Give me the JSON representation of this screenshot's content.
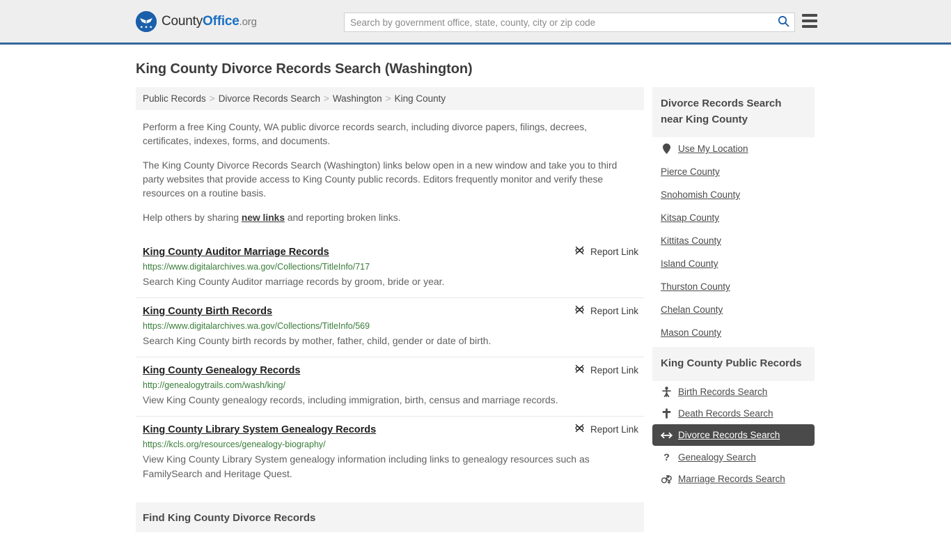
{
  "header": {
    "logo": {
      "icon": "eagle-shield-icon",
      "part1": "County",
      "part2": "Office",
      "part3": ".org"
    },
    "search": {
      "placeholder": "Search by government office, state, county, city or zip code",
      "value": "",
      "icon": "search-icon"
    },
    "menu_icon": "hamburger-menu-icon"
  },
  "page": {
    "title": "King County Divorce Records Search (Washington)"
  },
  "breadcrumb": {
    "items": [
      {
        "label": "Public Records"
      },
      {
        "label": "Divorce Records Search"
      },
      {
        "label": "Washington"
      },
      {
        "label": "King County"
      }
    ],
    "separator": ">"
  },
  "intro": {
    "p1": "Perform a free King County, WA public divorce records search, including divorce papers, filings, decrees, certificates, indexes, forms, and documents.",
    "p2": "The King County Divorce Records Search (Washington) links below open in a new window and take you to third party websites that provide access to King County public records. Editors frequently monitor and verify these resources on a routine basis.",
    "p3_before": "Help others by sharing ",
    "p3_link": "new links",
    "p3_after": " and reporting broken links."
  },
  "results": {
    "report_label": "Report Link",
    "report_icon": "broken-link-icon",
    "items": [
      {
        "title": "King County Auditor Marriage Records",
        "url": "https://www.digitalarchives.wa.gov/Collections/TitleInfo/717",
        "desc": "Search King County Auditor marriage records by groom, bride or year."
      },
      {
        "title": "King County Birth Records",
        "url": "https://www.digitalarchives.wa.gov/Collections/TitleInfo/569",
        "desc": "Search King County birth records by mother, father, child, gender or date of birth."
      },
      {
        "title": "King County Genealogy Records",
        "url": "http://genealogytrails.com/wash/king/",
        "desc": "View King County genealogy records, including immigration, birth, census and marriage records."
      },
      {
        "title": "King County Library System Genealogy Records",
        "url": "https://kcls.org/resources/genealogy-biography/",
        "desc": "View King County Library System genealogy information including links to genealogy resources such as FamilySearch and Heritage Quest."
      }
    ]
  },
  "find_section": {
    "heading": "Find King County Divorce Records"
  },
  "sidebar": {
    "nearby": {
      "heading": "Divorce Records Search near King County",
      "items": [
        {
          "label": "Use My Location",
          "icon": "map-pin-icon"
        },
        {
          "label": "Pierce County",
          "icon": ""
        },
        {
          "label": "Snohomish County",
          "icon": ""
        },
        {
          "label": "Kitsap County",
          "icon": ""
        },
        {
          "label": "Kittitas County",
          "icon": ""
        },
        {
          "label": "Island County",
          "icon": ""
        },
        {
          "label": "Thurston County",
          "icon": ""
        },
        {
          "label": "Chelan County",
          "icon": ""
        },
        {
          "label": "Mason County",
          "icon": ""
        }
      ]
    },
    "public_records": {
      "heading": "King County Public Records",
      "items": [
        {
          "label": "Birth Records Search",
          "icon": "baby-icon",
          "active": false
        },
        {
          "label": "Death Records Search",
          "icon": "cross-icon",
          "active": false
        },
        {
          "label": "Divorce Records Search",
          "icon": "left-right-arrow-icon",
          "active": true
        },
        {
          "label": "Genealogy Search",
          "icon": "question-mark-icon",
          "active": false
        },
        {
          "label": "Marriage Records Search",
          "icon": "male-female-icon",
          "active": false
        }
      ]
    }
  },
  "colors": {
    "header_bg": "#eeeeee",
    "header_border": "#34689c",
    "logo_blue": "#1b5fab",
    "link_green": "#3a7d3a",
    "active_bg": "#4a4a4a",
    "panel_bg": "#f4f4f4"
  }
}
